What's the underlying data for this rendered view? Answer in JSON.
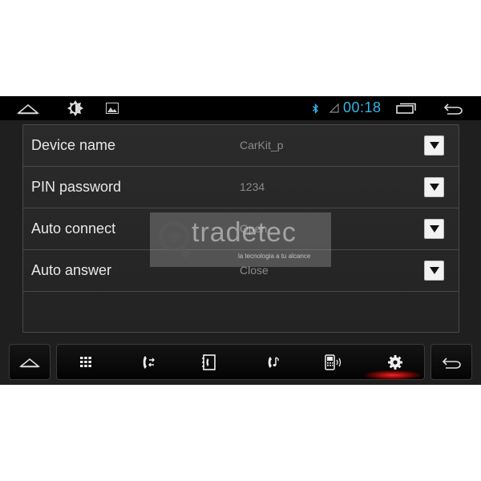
{
  "status_bar": {
    "time": "00:18",
    "icons": [
      "home-icon",
      "brightness-icon",
      "gallery-icon",
      "bluetooth-icon",
      "signal-icon",
      "recent-apps-icon",
      "back-icon"
    ],
    "accent_color": "#33b5e5"
  },
  "settings": {
    "rows": [
      {
        "label": "Device name",
        "value": "CarKit_p"
      },
      {
        "label": "PIN password",
        "value": "1234"
      },
      {
        "label": "Auto connect",
        "value": "Open"
      },
      {
        "label": "Auto answer",
        "value": "Close"
      }
    ]
  },
  "watermark": {
    "brand": "tradetec",
    "tagline": "la tecnologia a tu alcance"
  },
  "nav": {
    "items": [
      "home-icon",
      "dialpad-icon",
      "call-log-icon",
      "contacts-icon",
      "music-icon",
      "phone-device-icon",
      "settings-gear-icon",
      "back-icon"
    ],
    "active_color": "#e02020"
  }
}
